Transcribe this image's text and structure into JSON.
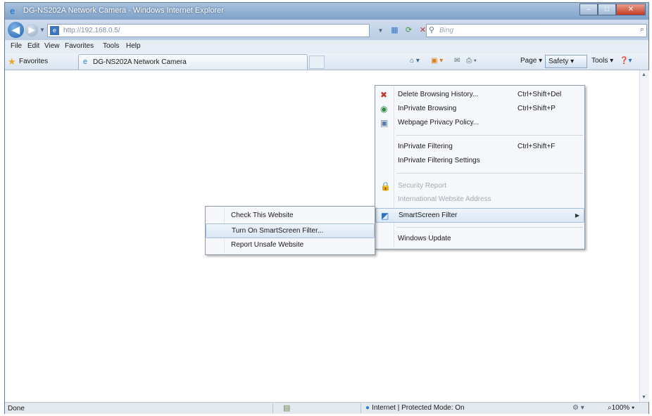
{
  "window": {
    "title": "DG-NS202A Network Camera - Windows Internet Explorer",
    "buttons": {
      "minimize": "–",
      "maximize": "□",
      "close": "✕"
    }
  },
  "nav": {
    "url": "http://192.168.0.5/",
    "search_placeholder": "Bing"
  },
  "menubar": [
    "File",
    "Edit",
    "View",
    "Favorites",
    "Tools",
    "Help"
  ],
  "favorites_bar": {
    "favorites_label": "Favorites",
    "tab_title": "DG-NS202A Network Camera"
  },
  "command_bar": {
    "page": "Page ▾",
    "safety": "Safety ▾",
    "tools": "Tools ▾"
  },
  "safety_menu": {
    "items": [
      {
        "label": "Delete Browsing History...",
        "shortcut": "Ctrl+Shift+Del",
        "icon": "delete-history-icon"
      },
      {
        "label": "InPrivate Browsing",
        "shortcut": "Ctrl+Shift+P",
        "icon": "inprivate-icon"
      },
      {
        "label": "Webpage Privacy Policy...",
        "shortcut": "",
        "icon": "privacy-icon"
      },
      {
        "label": "InPrivate Filtering",
        "shortcut": "Ctrl+Shift+F",
        "icon": ""
      },
      {
        "label": "InPrivate Filtering Settings",
        "shortcut": "",
        "icon": ""
      },
      {
        "label": "Security Report",
        "shortcut": "",
        "icon": "lock-icon",
        "disabled": true
      },
      {
        "label": "International Website Address",
        "shortcut": "",
        "icon": "",
        "disabled": true
      },
      {
        "label": "SmartScreen Filter",
        "shortcut": "",
        "icon": "smartscreen-icon",
        "highlighted": true,
        "submenu": true
      },
      {
        "label": "Windows Update",
        "shortcut": "",
        "icon": ""
      }
    ]
  },
  "smartscreen_submenu": {
    "items": [
      {
        "label": "Check This Website"
      },
      {
        "label": "Turn On SmartScreen Filter...",
        "highlighted": true
      },
      {
        "label": "Report Unsafe Website"
      }
    ]
  },
  "status_bar": {
    "status": "Done",
    "zone": "Internet | Protected Mode: On",
    "zoom": "100%"
  }
}
